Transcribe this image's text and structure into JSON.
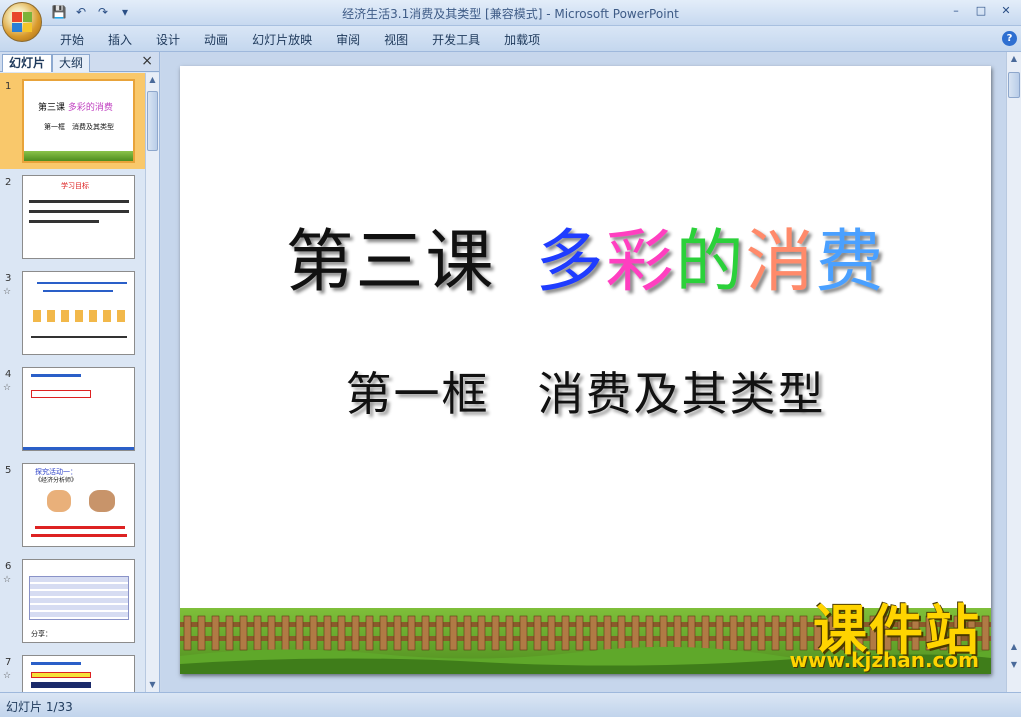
{
  "window": {
    "title": "经济生活3.1消费及其类型 [兼容模式] - Microsoft PowerPoint",
    "controls": [
      "–",
      "□",
      "✕"
    ]
  },
  "quick_access": [
    "save-icon",
    "undo-icon",
    "redo-icon",
    "customize-icon"
  ],
  "ribbon": {
    "tabs": [
      "开始",
      "插入",
      "设计",
      "动画",
      "幻灯片放映",
      "审阅",
      "视图",
      "开发工具",
      "加载项"
    ],
    "help": "?"
  },
  "panel": {
    "tab_slides": "幻灯片",
    "tab_outline": "大纲",
    "close": "×",
    "slides": [
      {
        "num": "1",
        "anim": ""
      },
      {
        "num": "2",
        "anim": ""
      },
      {
        "num": "3",
        "anim": "☆"
      },
      {
        "num": "4",
        "anim": "☆"
      },
      {
        "num": "5",
        "anim": ""
      },
      {
        "num": "6",
        "anim": "☆"
      },
      {
        "num": "7",
        "anim": "☆"
      }
    ],
    "thumb1": {
      "title_a": "第三课",
      "title_b": "多彩的消费",
      "sub": "第一框　消费及其类型"
    },
    "thumb2": {
      "head": "学习目标"
    },
    "thumb5": {
      "head": "探究活动一：",
      "sub": "《经济分析师》"
    },
    "thumb6": {
      "foot": "分享："
    }
  },
  "slide": {
    "title_plain": "第三课",
    "title_colored": [
      {
        "char": "多",
        "color": "#1f3cff"
      },
      {
        "char": "彩",
        "color": "#ff3fc0"
      },
      {
        "char": "的",
        "color": "#2bd13a"
      },
      {
        "char": "消",
        "color": "#ff8a6a"
      },
      {
        "char": "费",
        "color": "#4aa0ff"
      }
    ],
    "subtitle": "第一框　消费及其类型"
  },
  "watermark": {
    "main": "课件站",
    "url": "www.kjzhan.com"
  },
  "status": {
    "text": "幻灯片 1/33"
  }
}
